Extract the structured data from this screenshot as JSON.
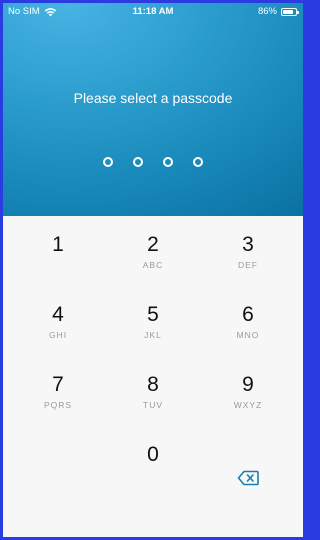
{
  "status_bar": {
    "carrier": "No SIM",
    "time": "11:18 AM",
    "battery": "86%",
    "battery_level": 0.86
  },
  "header": {
    "prompt": "Please select a passcode",
    "passcode_length": 4
  },
  "keypad": {
    "keys": [
      {
        "digit": "1",
        "letters": ""
      },
      {
        "digit": "2",
        "letters": "ABC"
      },
      {
        "digit": "3",
        "letters": "DEF"
      },
      {
        "digit": "4",
        "letters": "GHI"
      },
      {
        "digit": "5",
        "letters": "JKL"
      },
      {
        "digit": "6",
        "letters": "MNO"
      },
      {
        "digit": "7",
        "letters": "PQRS"
      },
      {
        "digit": "8",
        "letters": "TUV"
      },
      {
        "digit": "9",
        "letters": "WXYZ"
      },
      {
        "digit": "0",
        "letters": ""
      }
    ],
    "backspace_icon": "backspace-icon"
  },
  "colors": {
    "frame": "#2a3be0",
    "header_light": "#46b3e3",
    "header_dark": "#066a99",
    "keypad_background": "#f7f7f7",
    "accent": "#1b7fae"
  }
}
